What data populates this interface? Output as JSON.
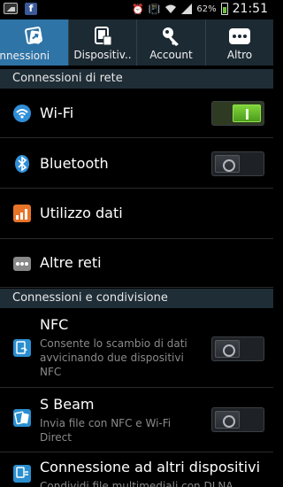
{
  "status_bar": {
    "battery_percent": "62%",
    "time": "21:51",
    "icons": [
      "image-icon",
      "facebook-icon",
      "alarm-icon",
      "vibrate-icon",
      "wifi-signal-icon",
      "cell-signal-icon",
      "battery-icon"
    ]
  },
  "tabs": [
    {
      "label": "onnessioni",
      "icon": "connections-icon",
      "active": true
    },
    {
      "label": "Dispositiv..",
      "icon": "device-icon",
      "active": false
    },
    {
      "label": "Account",
      "icon": "key-icon",
      "active": false
    },
    {
      "label": "Altro",
      "icon": "more-icon",
      "active": false
    }
  ],
  "sections": {
    "network": "Connessioni di rete",
    "sharing": "Connessioni e condivisione"
  },
  "items": {
    "wifi": {
      "title": "Wi-Fi",
      "toggle": "on"
    },
    "bluetooth": {
      "title": "Bluetooth",
      "toggle": "off"
    },
    "data_usage": {
      "title": "Utilizzo dati"
    },
    "other_networks": {
      "title": "Altre reti"
    },
    "nfc": {
      "title": "NFC",
      "desc": "Consente lo scambio di dati avvicinando due dispositivi NFC",
      "toggle": "off"
    },
    "sbeam": {
      "title": "S Beam",
      "desc": "Invia file con NFC e Wi-Fi Direct",
      "toggle": "off"
    },
    "other_devices": {
      "title": "Connessione ad altri dispositivi",
      "desc": "Condividi file multimediali con DLNA"
    }
  },
  "colors": {
    "accent": "#2f74a7",
    "tab_bar": "#1c2a33",
    "section_bg": "#1f2d36",
    "toggle_on": "#7fd43a"
  }
}
